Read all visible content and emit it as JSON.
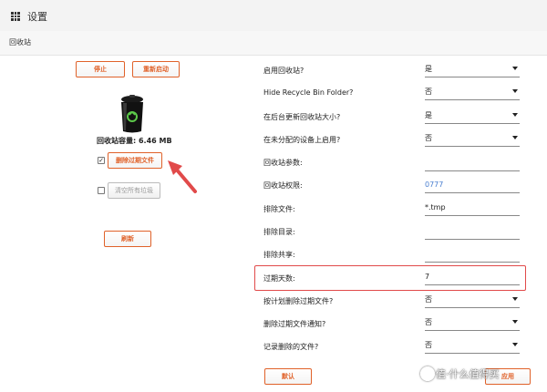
{
  "header": {
    "title": "设置"
  },
  "subheader": {
    "title": "回收站"
  },
  "left": {
    "stop_label": "停止",
    "restart_label": "重新启动",
    "capacity_label": "回收站容量: 6.46 MB",
    "delete_expired_label": "删除过期文件",
    "delete_expired_checked": true,
    "empty_all_label": "清空所有垃圾",
    "empty_all_checked": false,
    "refresh_label": "刷新"
  },
  "settings": [
    {
      "label": "启用回收站?",
      "type": "select",
      "value": "是"
    },
    {
      "label": "Hide Recycle Bin Folder?",
      "type": "select",
      "value": "否"
    },
    {
      "label": "在后台更新回收站大小?",
      "type": "select",
      "value": "是"
    },
    {
      "label": "在未分配的设备上启用?",
      "type": "select",
      "value": "否"
    },
    {
      "label": "回收站参数:",
      "type": "input",
      "value": ""
    },
    {
      "label": "回收站权限:",
      "type": "input",
      "value": "0777"
    },
    {
      "label": "排除文件:",
      "type": "input",
      "value": "*.tmp"
    },
    {
      "label": "排除目录:",
      "type": "input",
      "value": ""
    },
    {
      "label": "排除共享:",
      "type": "input",
      "value": ""
    },
    {
      "label": "过期天数:",
      "type": "input",
      "value": "7"
    },
    {
      "label": "按计划删除过期文件?",
      "type": "select",
      "value": "否"
    },
    {
      "label": "删除过期文件通知?",
      "type": "select",
      "value": "否"
    },
    {
      "label": "记录删除的文件?",
      "type": "select",
      "value": "否"
    }
  ],
  "footer": {
    "default_label": "默认",
    "apply_label": "应用"
  },
  "watermark": {
    "text": "值·什么值得买"
  },
  "colors": {
    "accent": "#e0622a",
    "highlight": "#e14a4a",
    "permission_value": "#4a7fd0"
  }
}
